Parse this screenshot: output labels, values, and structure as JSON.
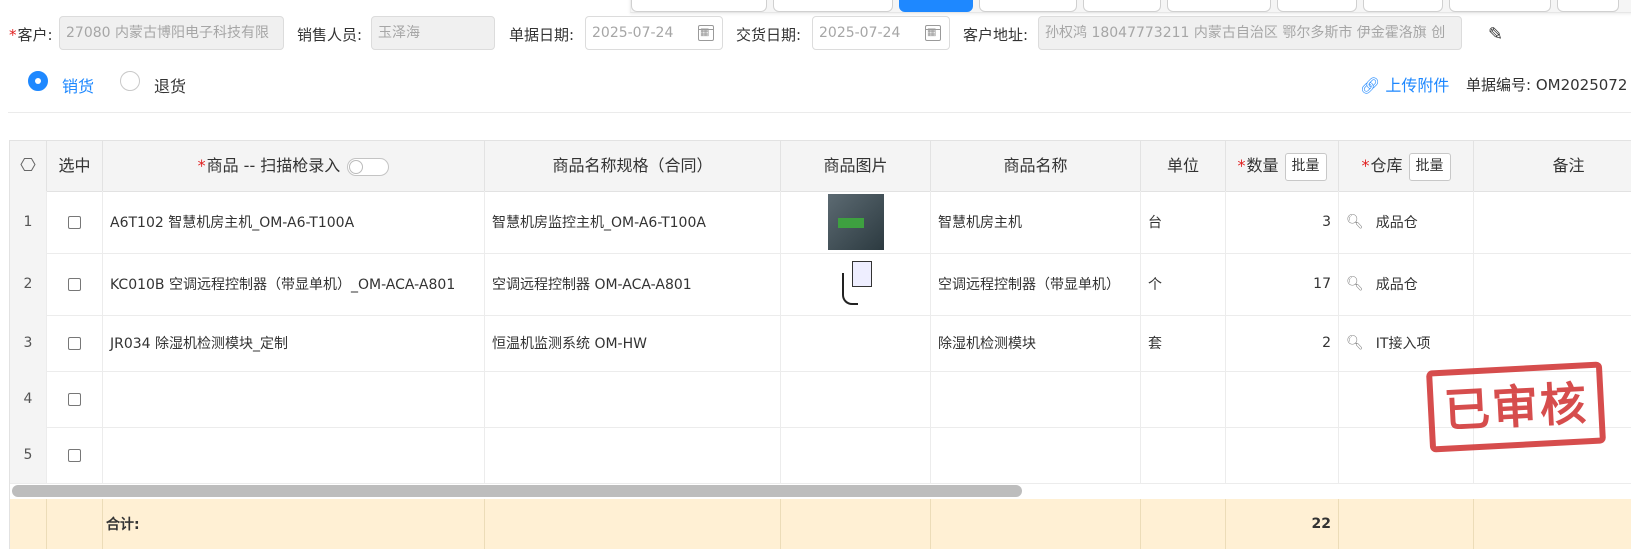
{
  "form": {
    "customer_label": "客户:",
    "customer_value": "27080 内蒙古博阳电子科技有限",
    "sales_label": "销售人员:",
    "sales_value": "玉泽海",
    "doc_date_label": "单据日期:",
    "doc_date_value": "2025-07-24",
    "delivery_date_label": "交货日期:",
    "delivery_date_value": "2025-07-24",
    "address_label": "客户地址:",
    "address_value": "孙权鸿 18047773211 内蒙古自治区 鄂尔多斯市 伊金霍洛旗 创"
  },
  "order_type": {
    "sale_label": "销货",
    "return_label": "退货",
    "selected": "销货"
  },
  "upload_label": "上传附件",
  "doc_no_label": "单据编号:",
  "doc_no_value": "OM2025072",
  "stamp_text": "已审核",
  "grid": {
    "headers": {
      "select": "选中",
      "product": "商品 -- 扫描枪录入",
      "spec": "商品名称规格（合同）",
      "image": "商品图片",
      "name": "商品名称",
      "unit": "单位",
      "qty": "数量",
      "warehouse": "仓库",
      "remark": "备注",
      "batch": "批量"
    },
    "rows": [
      {
        "idx": "1",
        "product": "A6T102 智慧机房主机_OM-A6-T100A",
        "spec": "智慧机房监控主机_OM-A6-T100A",
        "name": "智慧机房主机",
        "unit": "台",
        "qty": "3",
        "warehouse": "成品仓"
      },
      {
        "idx": "2",
        "product": "KC010B 空调远程控制器（带显单机）_OM-ACA-A801",
        "spec": "空调远程控制器 OM-ACA-A801",
        "name": "空调远程控制器（带显单机）",
        "unit": "个",
        "qty": "17",
        "warehouse": "成品仓"
      },
      {
        "idx": "3",
        "product": "JR034 除湿机检测模块_定制",
        "spec": "恒温机监测系统 OM-HW",
        "name": "除湿机检测模块",
        "unit": "套",
        "qty": "2",
        "warehouse": "IT接入项"
      },
      {
        "idx": "4",
        "product": "",
        "spec": "",
        "name": "",
        "unit": "",
        "qty": "",
        "warehouse": ""
      },
      {
        "idx": "5",
        "product": "",
        "spec": "",
        "name": "",
        "unit": "",
        "qty": "",
        "warehouse": ""
      }
    ],
    "footer": {
      "total_label": "合计:",
      "total_qty": "22"
    }
  },
  "colors": {
    "accent": "#1e88ff",
    "required": "#e02020",
    "stamp": "#d23a3a",
    "footer_bg": "#fff0d4"
  },
  "icons": [
    "calendar-icon",
    "edit-icon",
    "paperclip-icon",
    "settings-icon",
    "search-icon"
  ]
}
